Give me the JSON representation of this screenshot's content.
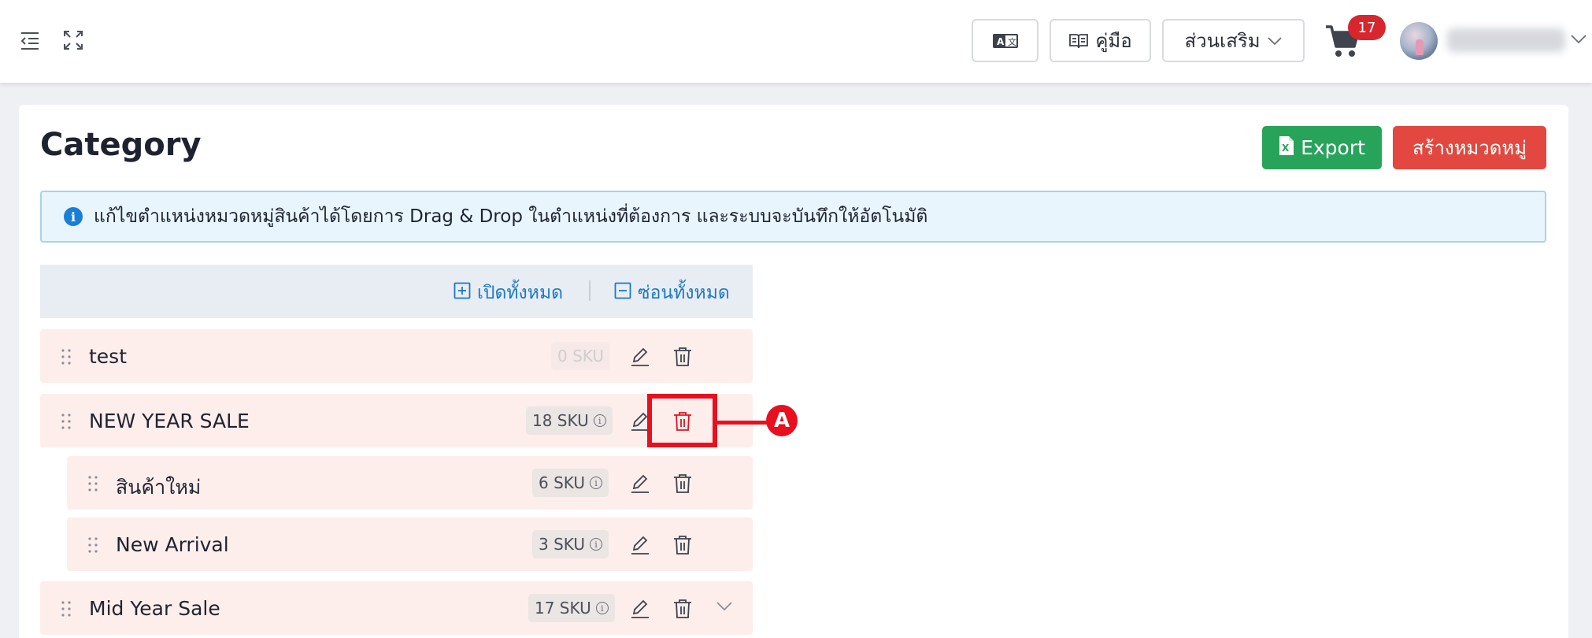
{
  "header": {
    "translate_icon": "translate-icon",
    "manual_label": "คู่มือ",
    "addons_label": "ส่วนเสริม",
    "cart_count": "17"
  },
  "page": {
    "title": "Category",
    "export_label": "Export",
    "create_label": "สร้างหมวดหมู่",
    "info_text": "แก้ไขตำแหน่งหมวดหมู่สินค้าได้โดยการ Drag & Drop ในตำแหน่งที่ต้องการ และระบบจะบันทึกให้อัตโนมัติ",
    "expand_all": "เปิดทั้งหมด",
    "collapse_all": "ซ่อนทั้งหมด"
  },
  "categories": [
    {
      "name": "test",
      "sku": "0 SKU"
    },
    {
      "name": "NEW YEAR SALE",
      "sku": "18 SKU"
    },
    {
      "name": "สินค้าใหม่",
      "sku": "6 SKU"
    },
    {
      "name": "New Arrival",
      "sku": "3 SKU"
    },
    {
      "name": "Mid Year Sale",
      "sku": "17 SKU"
    }
  ],
  "annotation": {
    "label": "A"
  },
  "colors": {
    "export_green": "#27a35a",
    "create_red": "#e2483f",
    "link_blue": "#1a79c4",
    "row_bg": "#fdeeec",
    "highlight_red": "#e8101e"
  }
}
